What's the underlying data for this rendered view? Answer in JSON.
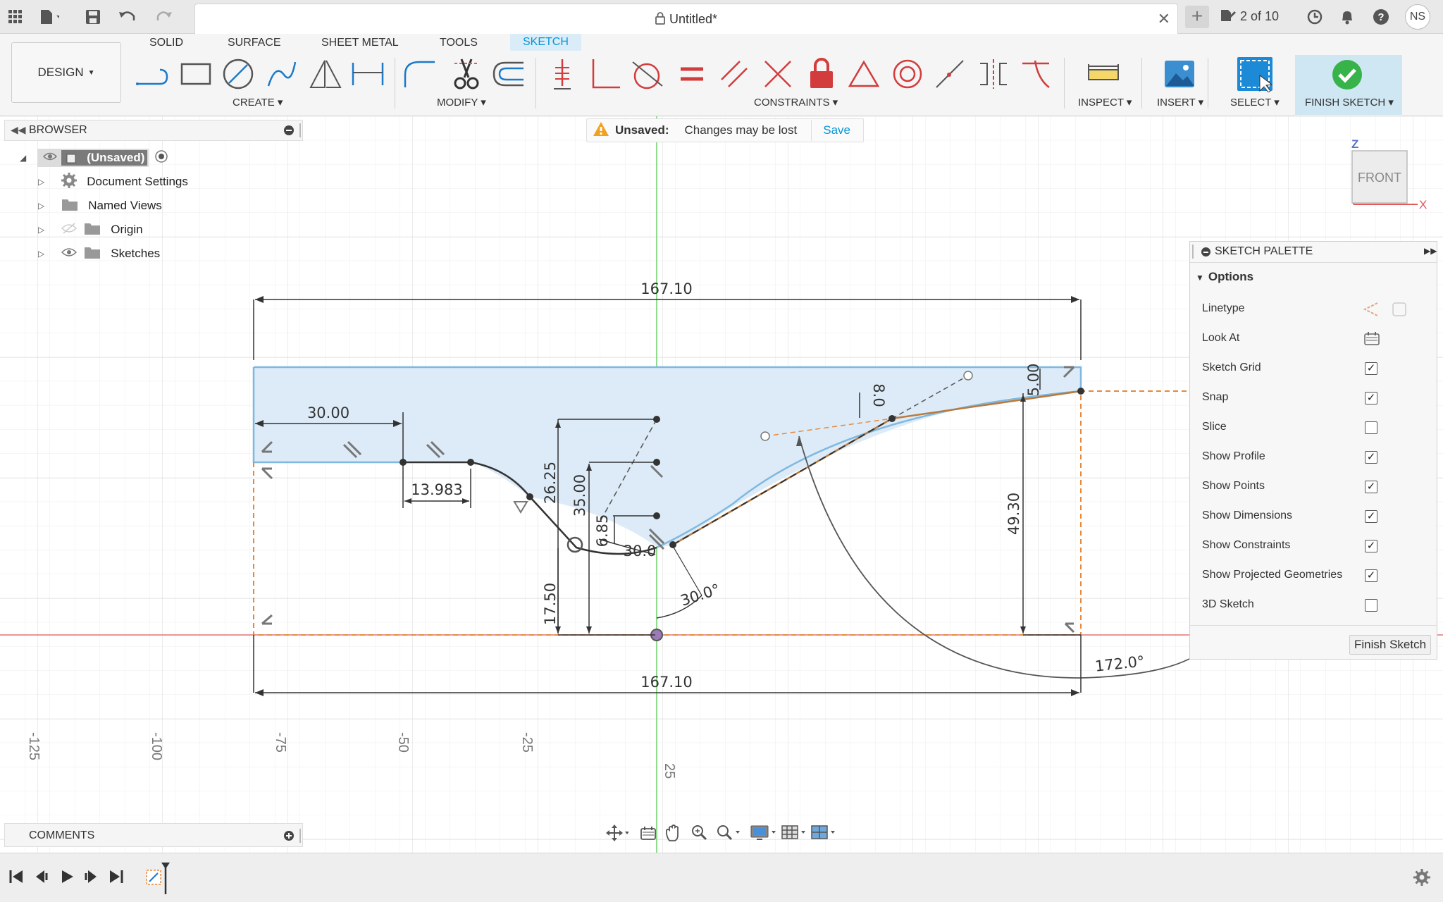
{
  "titlebar": {
    "doc_title": "Untitled*",
    "job_status": "2 of 10",
    "user_initials": "NS"
  },
  "toolbar": {
    "workspace": "DESIGN",
    "tabs": [
      "SOLID",
      "SURFACE",
      "SHEET METAL",
      "TOOLS",
      "SKETCH"
    ],
    "active_tab": "SKETCH",
    "groups": {
      "create": "CREATE",
      "modify": "MODIFY",
      "constraints": "CONSTRAINTS",
      "inspect": "INSPECT",
      "insert": "INSERT",
      "select": "SELECT",
      "finish": "FINISH SKETCH"
    }
  },
  "banner": {
    "label": "Unsaved:",
    "message": "Changes may be lost",
    "action": "Save"
  },
  "browser": {
    "title": "BROWSER",
    "root": "(Unsaved)",
    "items": [
      "Document Settings",
      "Named Views",
      "Origin",
      "Sketches"
    ]
  },
  "viewcube": {
    "face": "FRONT",
    "axis_z": "Z",
    "axis_x": "X"
  },
  "sketch": {
    "dimensions": {
      "top_width": "167.10",
      "bottom_width": "167.10",
      "left_flat": "30.00",
      "small_flat": "13.983",
      "height_26": "26.25",
      "height_35": "35.00",
      "small_h": "6.85",
      "height_17": "17.50",
      "angle_30a": "30.0",
      "angle_30b": "30.0°",
      "height_49": "49.30",
      "right_top": "5.00",
      "right_small": "8.0",
      "arc_angle": "172.0°"
    },
    "grid_labels": [
      "-125",
      "-100",
      "-75",
      "-50",
      "-25",
      "25"
    ]
  },
  "palette": {
    "title": "SKETCH PALETTE",
    "section": "Options",
    "rows": [
      {
        "label": "Linetype",
        "type": "icons"
      },
      {
        "label": "Look At",
        "type": "icon"
      },
      {
        "label": "Sketch Grid",
        "checked": true
      },
      {
        "label": "Snap",
        "checked": true
      },
      {
        "label": "Slice",
        "checked": false
      },
      {
        "label": "Show Profile",
        "checked": true
      },
      {
        "label": "Show Points",
        "checked": true
      },
      {
        "label": "Show Dimensions",
        "checked": true
      },
      {
        "label": "Show Constraints",
        "checked": true
      },
      {
        "label": "Show Projected Geometries",
        "checked": true
      },
      {
        "label": "3D Sketch",
        "checked": false
      }
    ],
    "finish_label": "Finish Sketch"
  },
  "comments": {
    "title": "COMMENTS"
  },
  "colors": {
    "accent": "#0696d7",
    "profile_fill": "#dcebf7",
    "axis_red": "#e05a5a",
    "axis_green": "#5cc85c",
    "projected": "#e8893a"
  }
}
